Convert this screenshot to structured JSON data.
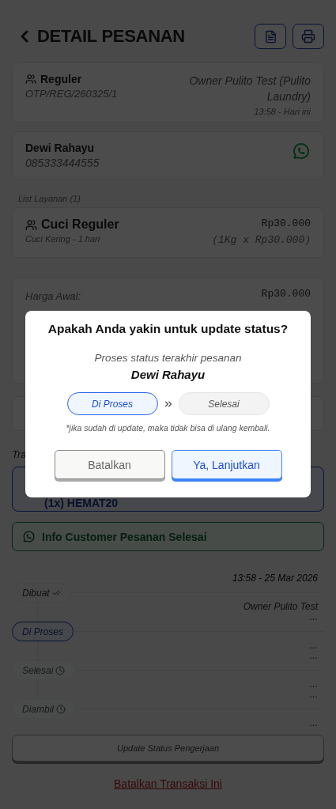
{
  "header": {
    "title": "DETAIL PESANAN"
  },
  "order": {
    "type": "Reguler",
    "code": "OTP/REG/260325/1",
    "owner": "Owner Pulito Test (Pulito Laundry)",
    "time": "13:58 - Hari ini"
  },
  "customer": {
    "name": "Dewi Rahayu",
    "phone": "085333444555"
  },
  "services_label": "List Layanan (1)",
  "services": [
    {
      "name": "Cuci Reguler",
      "detail": "Cuci Kering - 1 hari",
      "price": "Rp30.000",
      "calc": "(1Kg x Rp30.000)"
    }
  ],
  "price_summary": {
    "label": "Harga Awal:",
    "value": "Rp30.000"
  },
  "section_label": "Tra",
  "promo": {
    "text": "(1x) HEMAT20"
  },
  "whatsapp_button": "Info Customer Pesanan Selesai",
  "timeline": [
    {
      "label": "Dibuat",
      "kind": "done",
      "time": "13:58 - 25 Mar 2026",
      "by": "Owner Pulito Test"
    },
    {
      "label": "Di Proses",
      "kind": "active",
      "time": "...",
      "by": "..."
    },
    {
      "label": "Selesai",
      "kind": "pending",
      "time": "...",
      "by": "..."
    },
    {
      "label": "Diambil",
      "kind": "pending",
      "time": "...",
      "by": "..."
    }
  ],
  "update_button": "Update Status Pengerjaan",
  "cancel_link": "Batalkan Transaksi Ini",
  "dialog": {
    "title": "Apakah Anda yakin untuk update status?",
    "subtitle": "Proses status terakhir pesanan",
    "name": "Dewi Rahayu",
    "statuses": [
      {
        "label": "Di Proses",
        "current": true
      },
      {
        "label": "Selesai",
        "current": false
      }
    ],
    "note": "*jika sudah di update, maka tidak bisa di ulang kembali.",
    "buttons": [
      {
        "label": "Batalkan",
        "kind": "secondary"
      },
      {
        "label": "Ya, Lanjutkan",
        "kind": "primary"
      }
    ]
  }
}
